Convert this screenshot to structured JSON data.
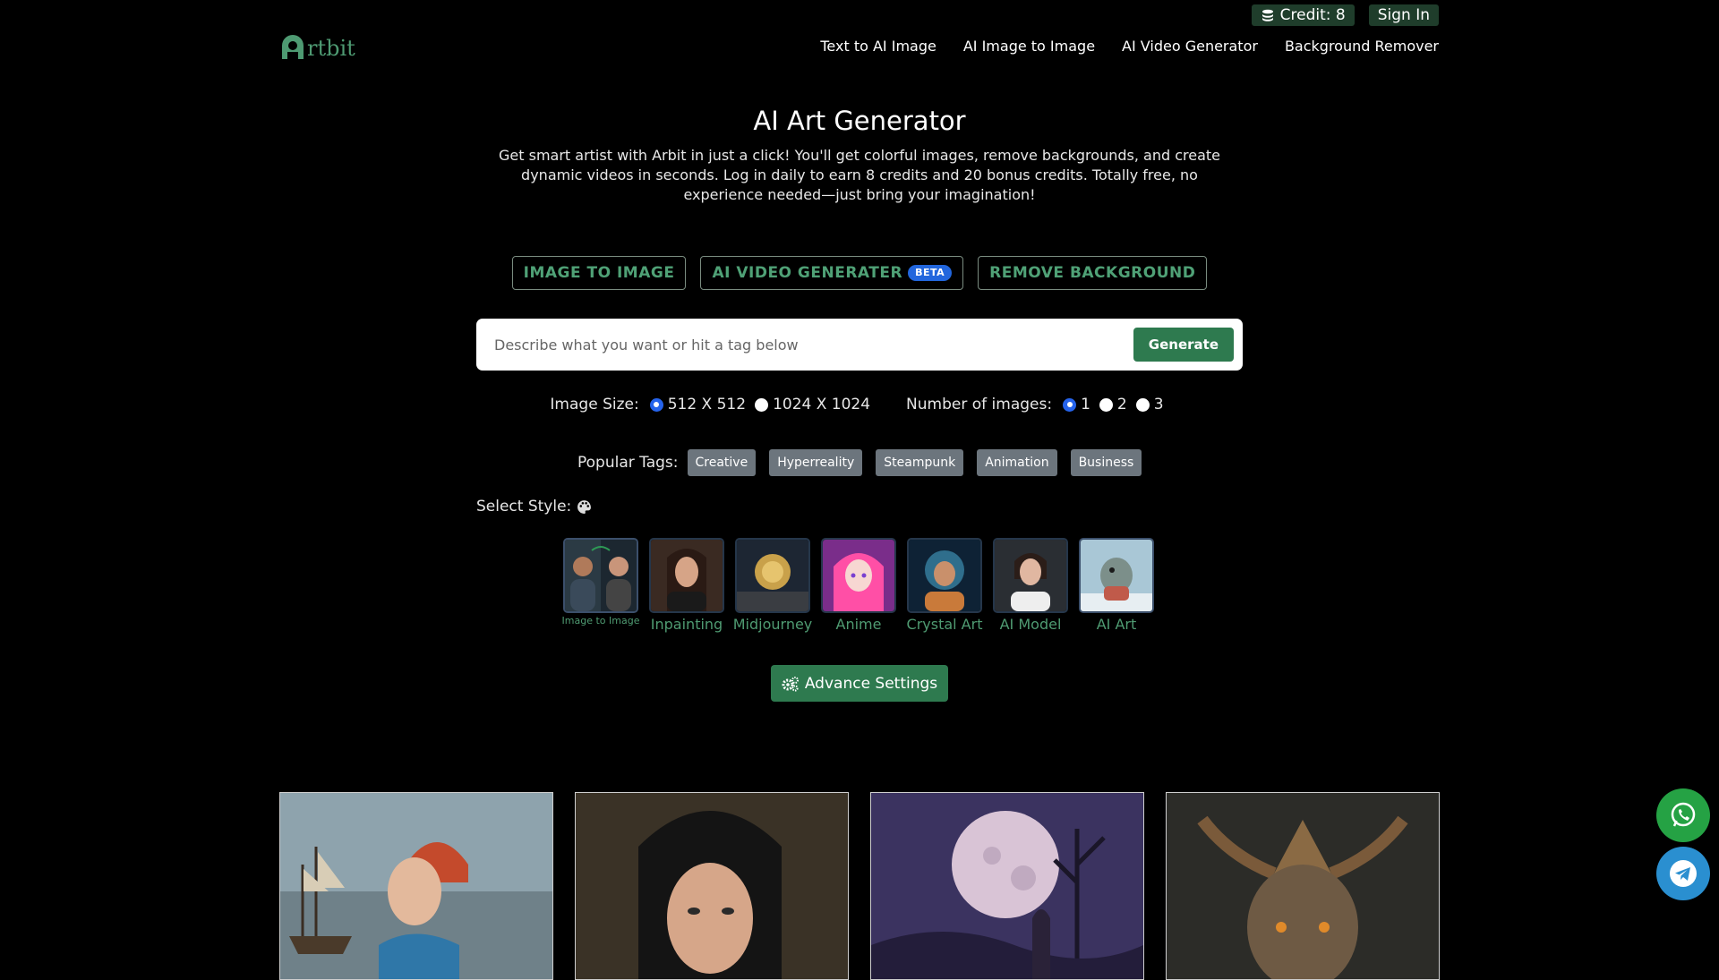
{
  "header": {
    "credit_label": "Credit: 8",
    "signin_label": "Sign In",
    "logo_text": "rtbit",
    "nav": [
      "Text to AI Image",
      "AI Image to Image",
      "AI Video Generator",
      "Background Remover"
    ]
  },
  "hero": {
    "title": "AI Art Generator",
    "description": "Get smart artist with Arbit in just a click! You'll get colorful images, remove backgrounds, and create dynamic videos in seconds. Log in daily to earn 8 credits and 20 bonus credits. Totally free, no experience needed—just bring your imagination!"
  },
  "modes": {
    "image_to_image": "IMAGE TO IMAGE",
    "video": "AI VIDEO GENERATER",
    "video_badge": "BETA",
    "remove_bg": "REMOVE BACKGROUND"
  },
  "prompt": {
    "placeholder": "Describe what you want or hit a tag below",
    "value": "",
    "generate_label": "Generate"
  },
  "options": {
    "size_label": "Image Size:",
    "sizes": [
      "512 X 512",
      "1024 X 1024"
    ],
    "selected_size": "512 X 512",
    "count_label": "Number of images:",
    "counts": [
      "1",
      "2",
      "3"
    ],
    "selected_count": "1"
  },
  "tags": {
    "label": "Popular Tags:",
    "items": [
      "Creative",
      "Hyperreality",
      "Steampunk",
      "Animation",
      "Business"
    ]
  },
  "styles": {
    "label": "Select Style:",
    "items": [
      "Image to Image",
      "Inpainting",
      "Midjourney",
      "Anime",
      "Crystal Art",
      "AI Model",
      "AI Art"
    ]
  },
  "advance_label": "Advance Settings",
  "colors": {
    "accent_green": "#2e7a4f",
    "link_green": "#4fa176",
    "background": "#000000"
  }
}
